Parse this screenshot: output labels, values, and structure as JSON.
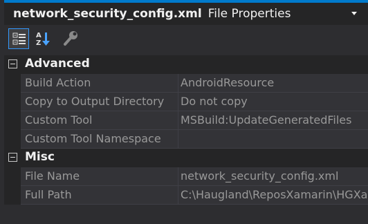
{
  "selector": {
    "object_name": "network_security_config.xml",
    "object_type": "File Properties"
  },
  "toolbar": {
    "buttons": [
      {
        "icon": "categorized-icon",
        "active": true
      },
      {
        "icon": "alphabetical-icon",
        "active": false
      },
      {
        "icon": "property-pages-wrench-icon",
        "active": false
      }
    ]
  },
  "categories": [
    {
      "label": "Advanced",
      "properties": [
        {
          "name": "Build Action",
          "value": "AndroidResource"
        },
        {
          "name": "Copy to Output Directory",
          "value": "Do not copy"
        },
        {
          "name": "Custom Tool",
          "value": "MSBuild:UpdateGeneratedFiles"
        },
        {
          "name": "Custom Tool Namespace",
          "value": ""
        }
      ]
    },
    {
      "label": "Misc",
      "properties": [
        {
          "name": "File Name",
          "value": "network_security_config.xml"
        },
        {
          "name": "Full Path",
          "value": "C:\\Haugland\\ReposXamarin\\HGXa"
        }
      ]
    }
  ],
  "colors": {
    "accent": "#007acc",
    "background": "#2d2d30",
    "row": "#333337",
    "text_dim": "#999999",
    "text": "#f1f1f1"
  }
}
